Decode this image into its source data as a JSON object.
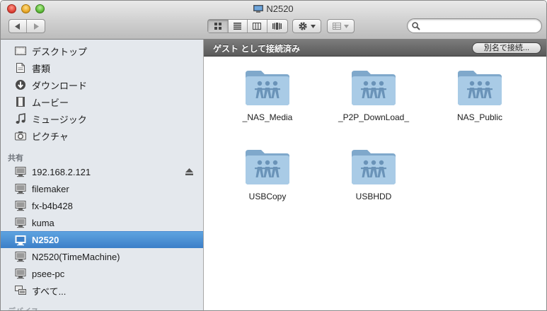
{
  "window": {
    "title": "N2520"
  },
  "sidebar": {
    "favorites": [
      {
        "label": "デスクトップ",
        "icon": "desktop-icon"
      },
      {
        "label": "書類",
        "icon": "documents-icon"
      },
      {
        "label": "ダウンロード",
        "icon": "downloads-icon"
      },
      {
        "label": "ムービー",
        "icon": "movies-icon"
      },
      {
        "label": "ミュージック",
        "icon": "music-icon"
      },
      {
        "label": "ピクチャ",
        "icon": "pictures-icon"
      }
    ],
    "shared_heading": "共有",
    "shared": [
      {
        "label": "192.168.2.121",
        "icon": "computer-icon"
      },
      {
        "label": "filemaker",
        "icon": "computer-icon"
      },
      {
        "label": "fx-b4b428",
        "icon": "computer-icon"
      },
      {
        "label": "kuma",
        "icon": "computer-icon"
      },
      {
        "label": "N2520",
        "icon": "computer-icon",
        "selected": true
      },
      {
        "label": "N2520(TimeMachine)",
        "icon": "computer-icon"
      },
      {
        "label": "psee-pc",
        "icon": "computer-icon"
      },
      {
        "label": "すべて...",
        "icon": "network-icon"
      }
    ],
    "devices_heading": "デバイス"
  },
  "content": {
    "status": "ゲスト として接続済み",
    "connect_as": "別名で接続...",
    "folders": [
      {
        "name": "_NAS_Media"
      },
      {
        "name": "_P2P_DownLoad_"
      },
      {
        "name": "NAS_Public"
      },
      {
        "name": "USBCopy"
      },
      {
        "name": "USBHDD"
      }
    ]
  },
  "search": {
    "value": "",
    "placeholder": ""
  },
  "colors": {
    "selection": "#3c7fc8",
    "sidebar_bg": "#e4e8ed",
    "folder": "#8fb6d6"
  }
}
